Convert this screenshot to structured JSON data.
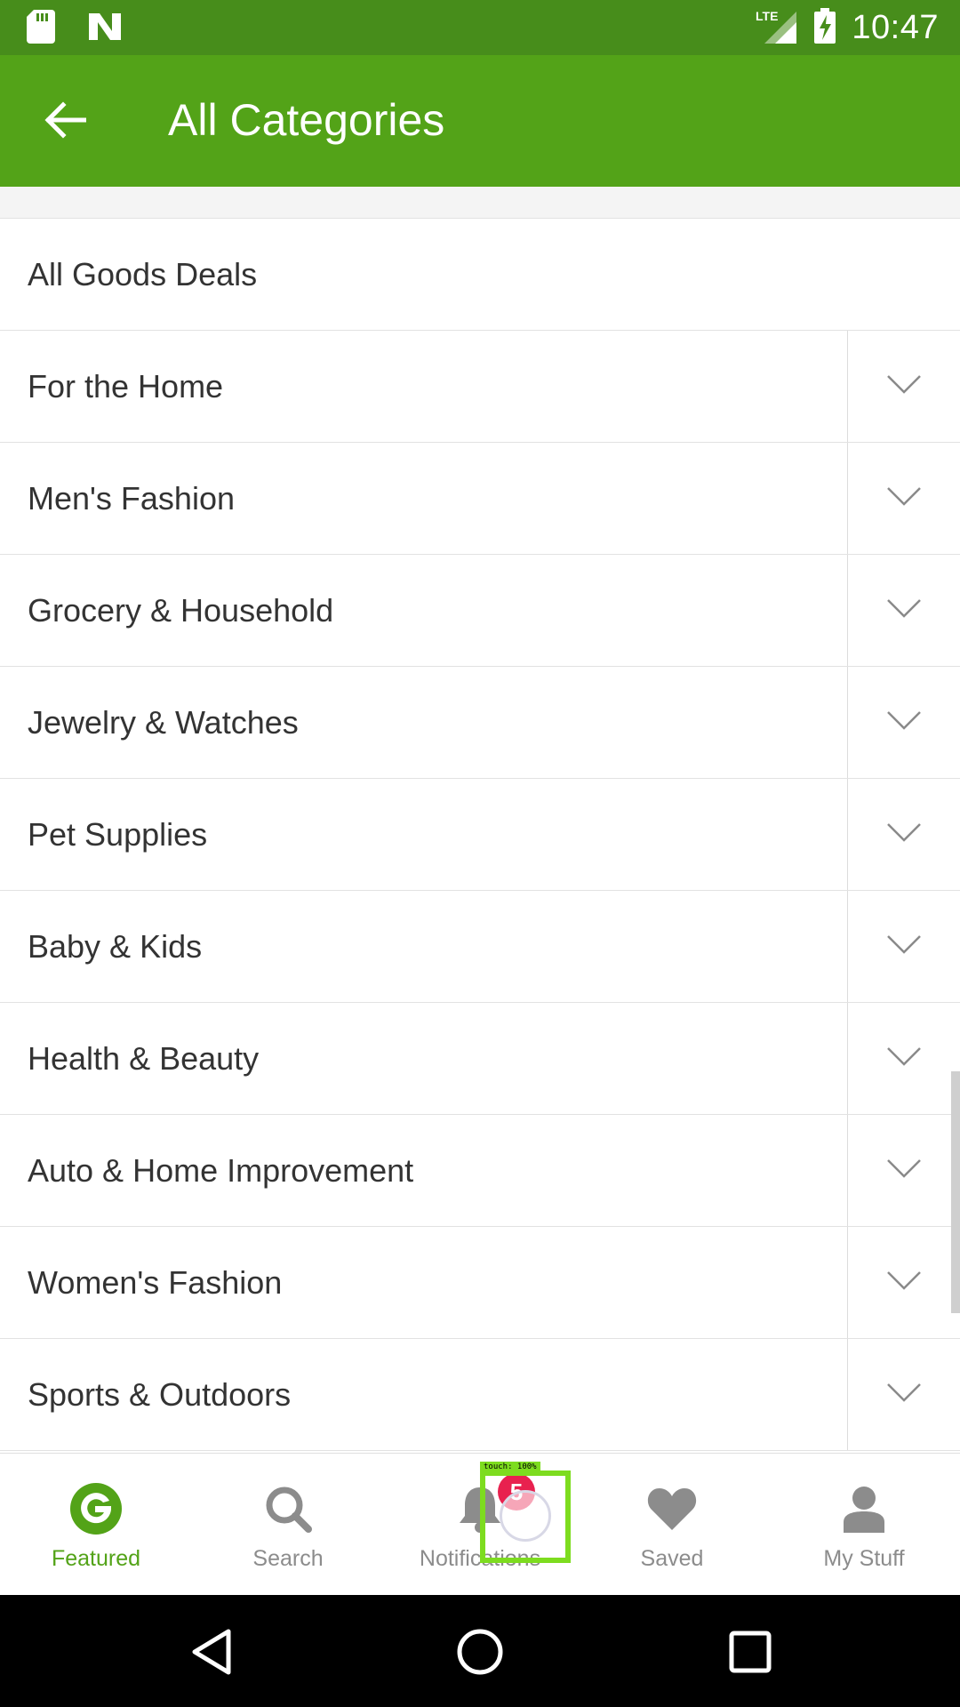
{
  "status_bar": {
    "time": "10:47",
    "network": "LTE",
    "icons": [
      "sd-card-icon",
      "n-notification-icon",
      "lte-signal-icon",
      "battery-charging-icon"
    ]
  },
  "app_bar": {
    "title": "All Categories",
    "back_icon": "arrow-left-icon"
  },
  "categories": [
    {
      "label": "All Goods Deals",
      "expandable": false
    },
    {
      "label": "For the Home",
      "expandable": true
    },
    {
      "label": "Men's Fashion",
      "expandable": true
    },
    {
      "label": "Grocery & Household",
      "expandable": true
    },
    {
      "label": "Jewelry & Watches",
      "expandable": true
    },
    {
      "label": "Pet Supplies",
      "expandable": true
    },
    {
      "label": "Baby & Kids",
      "expandable": true
    },
    {
      "label": "Health & Beauty",
      "expandable": true
    },
    {
      "label": "Auto & Home Improvement",
      "expandable": true
    },
    {
      "label": "Women's Fashion",
      "expandable": true
    },
    {
      "label": "Sports & Outdoors",
      "expandable": true
    }
  ],
  "bottom_nav": {
    "items": [
      {
        "label": "Featured",
        "icon": "groupon-g-icon",
        "active": true
      },
      {
        "label": "Search",
        "icon": "search-icon",
        "active": false
      },
      {
        "label": "Notifications",
        "icon": "bell-icon",
        "active": false,
        "badge": "5"
      },
      {
        "label": "Saved",
        "icon": "heart-icon",
        "active": false
      },
      {
        "label": "My Stuff",
        "icon": "person-icon",
        "active": false
      }
    ]
  },
  "touch_overlay": {
    "label": "touch: 100%"
  },
  "colors": {
    "status_bar": "#478d1b",
    "app_bar": "#53a318",
    "active_nav": "#53a318",
    "inactive_nav": "#8c8c8c",
    "badge": "#e8214f",
    "touch_box": "#7ddc1f"
  }
}
